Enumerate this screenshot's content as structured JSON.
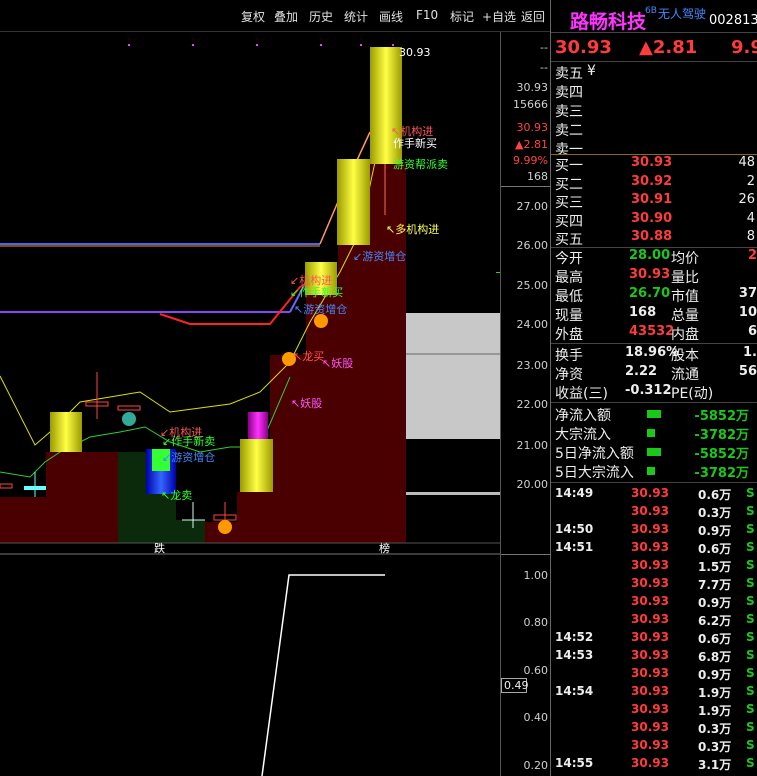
{
  "toolbar": {
    "items": [
      "复权",
      "叠加",
      "历史",
      "统计",
      "画线",
      "F10",
      "标记",
      "+自选",
      "返回"
    ],
    "icons": [
      "diamond-icon",
      "window-restore-icon"
    ]
  },
  "stock": {
    "name": "路畅科技",
    "tag": "6B",
    "subtitle": "无人驾驶",
    "code": "002813",
    "price": "30.93",
    "change": "▲2.81",
    "pct_partial": "9.9"
  },
  "axis": {
    "top_label": "30.93",
    "dash1": "--",
    "dash2": "--",
    "val1": "30.93",
    "vol": "15666",
    "red_price": "30.93",
    "red_change": "▲2.81",
    "red_pct": "9.99%",
    "cur": "168",
    "ticks": [
      "27.00",
      "26.00",
      "25.00",
      "24.00",
      "23.00",
      "22.00",
      "21.00",
      "20.00"
    ],
    "lower_ticks": [
      "1.00",
      "0.80",
      "0.60",
      "0.40",
      "0.20"
    ],
    "lower_box": "0.49"
  },
  "chart_labels": {
    "die": "跌",
    "bang": "榜",
    "a1": "↖机构进",
    "a2": "作手新买",
    "a3": "游资帮派卖",
    "a4": "↖多机构进",
    "a5": "↙游资增仓",
    "a6": "↙机构进",
    "a7": "↙作手新买",
    "a8": "↖游资增仓",
    "a9": "↖龙买",
    "a10": "↖妖股",
    "a11": "↖妖股",
    "a12": "↙机构进",
    "a13": "↙作手新卖",
    "a14": "↙游资增仓",
    "a15": "↖龙卖"
  },
  "orderbook": {
    "sell": [
      "卖五",
      "卖四",
      "卖三",
      "卖二",
      "卖一"
    ],
    "sell_extra": "¥",
    "buy": [
      {
        "label": "买一",
        "price": "30.93",
        "vol": "48"
      },
      {
        "label": "买二",
        "price": "30.92",
        "vol": "2"
      },
      {
        "label": "买三",
        "price": "30.91",
        "vol": "26"
      },
      {
        "label": "买四",
        "price": "30.90",
        "vol": "4"
      },
      {
        "label": "买五",
        "price": "30.88",
        "vol": "8"
      }
    ]
  },
  "stats": [
    {
      "l1": "今开",
      "v1": "28.00",
      "c1": "green",
      "l2": "均价",
      "v2": "2"
    },
    {
      "l1": "最高",
      "v1": "30.93",
      "c1": "red",
      "l2": "量比",
      "v2": ""
    },
    {
      "l1": "最低",
      "v1": "26.70",
      "c1": "green",
      "l2": "市值",
      "v2": "37"
    },
    {
      "l1": "现量",
      "v1": "168",
      "c1": "white",
      "l2": "总量",
      "v2": "10"
    },
    {
      "l1": "外盘",
      "v1": "43532",
      "c1": "red",
      "l2": "内盘",
      "v2": "6"
    }
  ],
  "stats2": [
    {
      "l1": "换手",
      "v1": "18.96%",
      "l2": "股本",
      "v2": "1."
    },
    {
      "l1": "净资",
      "v1": "2.22",
      "l2": "流通",
      "v2": "56"
    },
    {
      "l1": "收益(三)",
      "v1": "-0.312",
      "l2": "PE(动)",
      "v2": ""
    }
  ],
  "flows": [
    {
      "label": "净流入额",
      "value": "-5852万"
    },
    {
      "label": "大宗流入",
      "value": "-3782万"
    },
    {
      "label": "5日净流入额",
      "value": "-5852万"
    },
    {
      "label": "5日大宗流入",
      "value": "-3782万"
    }
  ],
  "trades": [
    {
      "t": "14:49",
      "p": "30.93",
      "v": "0.6万",
      "s": "S"
    },
    {
      "t": "",
      "p": "30.93",
      "v": "0.3万",
      "s": "S"
    },
    {
      "t": "14:50",
      "p": "30.93",
      "v": "0.9万",
      "s": "S"
    },
    {
      "t": "14:51",
      "p": "30.93",
      "v": "0.6万",
      "s": "S"
    },
    {
      "t": "",
      "p": "30.93",
      "v": "1.5万",
      "s": "S"
    },
    {
      "t": "",
      "p": "30.93",
      "v": "7.7万",
      "s": "S"
    },
    {
      "t": "",
      "p": "30.93",
      "v": "0.9万",
      "s": "S"
    },
    {
      "t": "",
      "p": "30.93",
      "v": "6.2万",
      "s": "S"
    },
    {
      "t": "14:52",
      "p": "30.93",
      "v": "0.6万",
      "s": "S"
    },
    {
      "t": "14:53",
      "p": "30.93",
      "v": "6.8万",
      "s": "S"
    },
    {
      "t": "",
      "p": "30.93",
      "v": "0.9万",
      "s": "S"
    },
    {
      "t": "14:54",
      "p": "30.93",
      "v": "1.9万",
      "s": "S"
    },
    {
      "t": "",
      "p": "30.93",
      "v": "1.9万",
      "s": "S"
    },
    {
      "t": "",
      "p": "30.93",
      "v": "0.3万",
      "s": "S"
    },
    {
      "t": "",
      "p": "30.93",
      "v": "0.3万",
      "s": "S"
    },
    {
      "t": "14:55",
      "p": "30.93",
      "v": "3.1万",
      "s": "S"
    }
  ]
}
